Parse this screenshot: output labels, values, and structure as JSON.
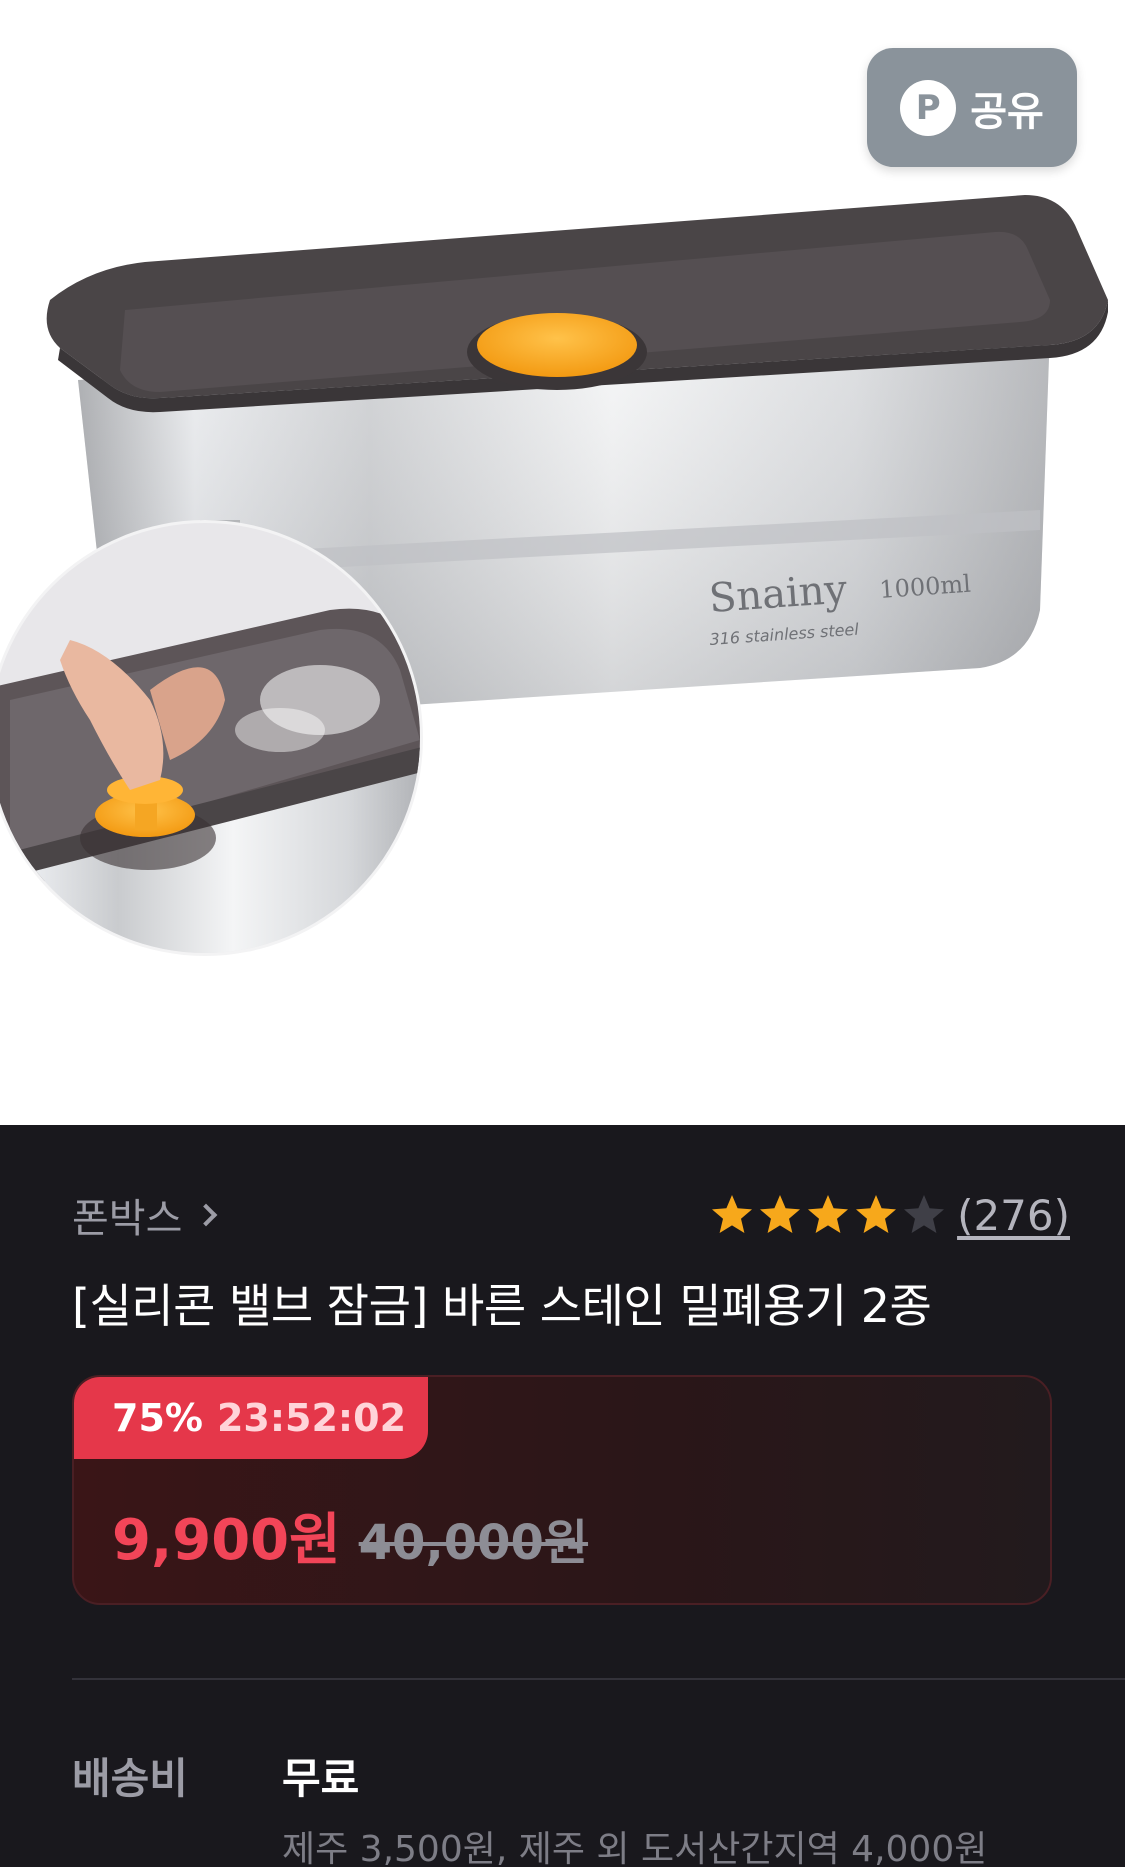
{
  "hero": {
    "share_label": "공유",
    "share_icon": "P",
    "product_brand_text": "Snainy",
    "product_volume_text": "1000ml",
    "product_material_text": "316 stainless steel",
    "accent_color": "#f7a81b",
    "lid_color": "#4a4547"
  },
  "seller": {
    "name": "폰박스"
  },
  "rating": {
    "stars": 4,
    "max": 5,
    "count": "(276)"
  },
  "product": {
    "title": "[실리콘 밸브 잠금] 바른 스테인 밀폐용기 2종"
  },
  "deal": {
    "discount": "75%",
    "timer": "23:52:02",
    "sale_price": "9,900원",
    "original_price": "40,000원"
  },
  "shipping": {
    "label": "배송비",
    "value": "무료",
    "note": "제주 3,500원, 제주 외 도서산간지역 4,000원"
  },
  "colors": {
    "accent_red": "#e5374a",
    "star": "#f7a81b",
    "background": "#19181d"
  }
}
